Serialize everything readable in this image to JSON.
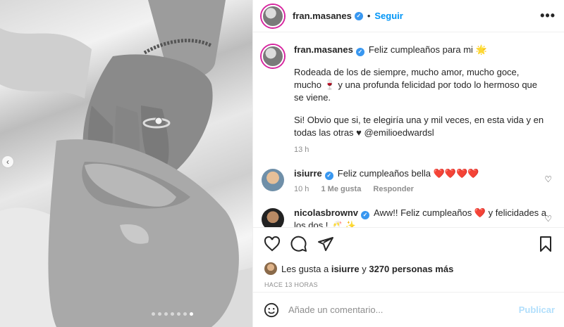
{
  "post": {
    "username": "fran.masanes",
    "follow_label": "Seguir",
    "more_label": "•••",
    "separator": "•"
  },
  "caption": {
    "username": "fran.masanes",
    "line1": "Feliz cumpleaños para mi 🌟",
    "para2": "Rodeada de los de siempre, mucho amor, mucho goce, mucho 🍷 y una profunda felicidad por todo lo hermoso que se viene.",
    "para3": "Si! Obvio que si, te elegiría una y mil veces, en esta vida y en todas las otras ♥ @emilioedwardsl",
    "time": "13 h"
  },
  "comments": [
    {
      "username": "isiurre",
      "text": "Feliz cumpleaños bella ❤️❤️❤️❤️",
      "time": "10 h",
      "likes": "1 Me gusta",
      "reply": "Responder"
    },
    {
      "username": "nicolasbrownv",
      "text": "Aww!! Feliz cumpleaños ❤️ y felicidades a los dos ! 🥂 ✨"
    }
  ],
  "likes": {
    "prefix": "Les gusta a",
    "user": "isiurre",
    "joiner": "y",
    "others": "3270 personas más"
  },
  "timestamp": "HACE 13 HORAS",
  "composer": {
    "placeholder": "Añade un comentario...",
    "publish_label": "Publicar"
  },
  "carousel": {
    "dots": 7,
    "active_index": 6
  },
  "colors": {
    "accent": "#0095f6",
    "verified": "#3897f0",
    "heart": "#ed4956",
    "publish_disabled": "#b2dffc"
  },
  "icons": [
    "chevron-left-icon",
    "more-icon",
    "verified-icon",
    "heart-icon",
    "comment-icon",
    "share-icon",
    "bookmark-icon",
    "emoji-icon"
  ]
}
